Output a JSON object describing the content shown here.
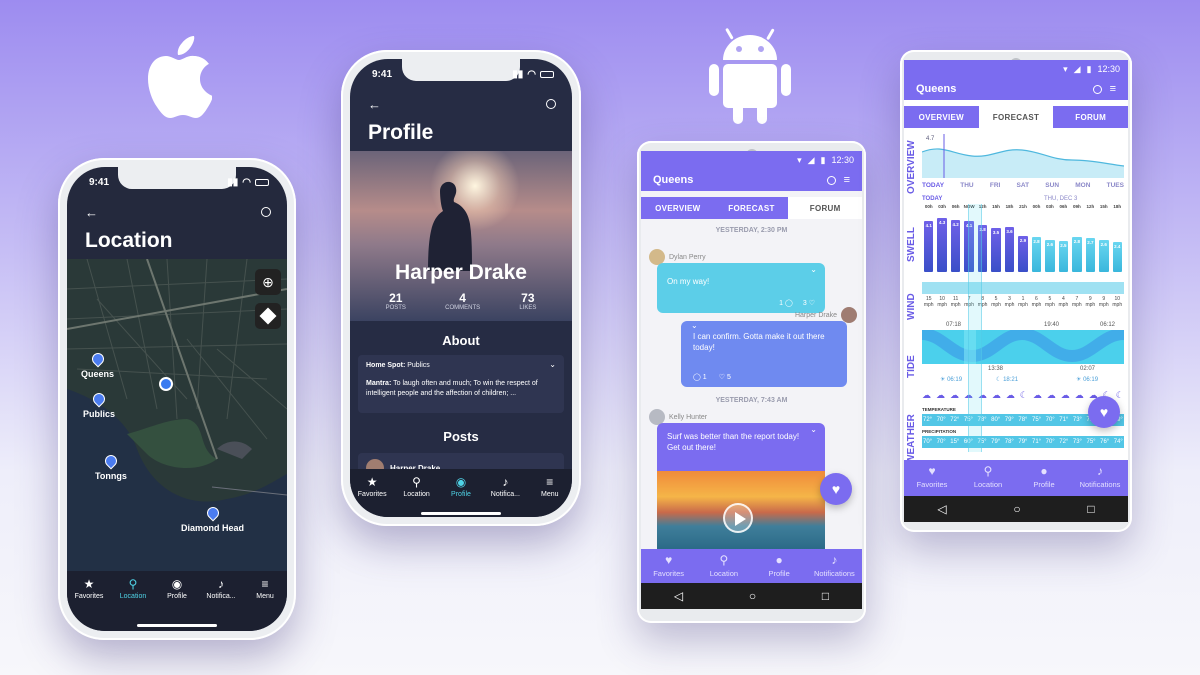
{
  "phone1": {
    "time": "9:41",
    "title": "Location",
    "map_labels": {
      "queens": "Queens",
      "publics": "Publics",
      "tonngs": "Tonngs",
      "diamond_head": "Diamond Head"
    },
    "tabs": [
      {
        "label": "Favorites",
        "icon": "star-icon"
      },
      {
        "label": "Location",
        "icon": "location-pin-icon"
      },
      {
        "label": "Profile",
        "icon": "user-icon"
      },
      {
        "label": "Notifica...",
        "icon": "bell-icon"
      },
      {
        "label": "Menu",
        "icon": "sliders-icon"
      }
    ]
  },
  "phone2": {
    "time": "9:41",
    "title": "Profile",
    "name": "Harper Drake",
    "stats": [
      {
        "value": "21",
        "label": "POSTS"
      },
      {
        "value": "4",
        "label": "COMMENTS"
      },
      {
        "value": "73",
        "label": "LIKES"
      }
    ],
    "about_heading": "About",
    "home_spot_label": "Home Spot:",
    "home_spot_value": "Publics",
    "mantra_label": "Mantra:",
    "mantra_value": "To laugh often and much; To win the respect of intelligent people and the affection of children; ...",
    "posts_heading": "Posts",
    "post_author": "Harper Drake",
    "tabs": [
      {
        "label": "Favorites",
        "icon": "star-icon"
      },
      {
        "label": "Location",
        "icon": "location-pin-icon"
      },
      {
        "label": "Profile",
        "icon": "user-icon"
      },
      {
        "label": "Notifica...",
        "icon": "bell-icon"
      },
      {
        "label": "Menu",
        "icon": "sliders-icon"
      }
    ]
  },
  "phone3": {
    "time": "12:30",
    "title": "Queens",
    "tabs": [
      "OVERVIEW",
      "FORECAST",
      "FORUM"
    ],
    "day1": "YESTERDAY, 2:30 PM",
    "msg1": {
      "author": "Dylan Perry",
      "text": "On my way!",
      "comments": "1",
      "likes": "3"
    },
    "msg2": {
      "author": "Harper Drake",
      "text": "I can confirm. Gotta make it out there today!",
      "comments": "1",
      "likes": "5"
    },
    "day2": "YESTERDAY, 7:43 AM",
    "msg3": {
      "author": "Kelly Hunter",
      "text": "Surf was better than the report today! Get out there!"
    },
    "nav": [
      {
        "label": "Favorites",
        "icon": "heart-icon"
      },
      {
        "label": "Location",
        "icon": "location-pin-icon"
      },
      {
        "label": "Profile",
        "icon": "user-icon"
      },
      {
        "label": "Notifications",
        "icon": "bell-icon"
      }
    ]
  },
  "phone4": {
    "time": "12:30",
    "title": "Queens",
    "tabs": [
      "OVERVIEW",
      "FORECAST",
      "FORUM"
    ],
    "side_labels": [
      "OVERVIEW",
      "SWELL",
      "WIND",
      "TIDE",
      "WEATHER"
    ],
    "overview_value": "4.7",
    "days": [
      "TODAY",
      "THU",
      "FRI",
      "SAT",
      "SUN",
      "MON",
      "TUES"
    ],
    "subheads": {
      "today": "TODAY",
      "next": "THU, DEC 3"
    },
    "hours": [
      "00h",
      "03h",
      "06h",
      "NOW",
      "12h",
      "15h",
      "18h",
      "21h",
      "00h",
      "03h",
      "06h",
      "09h",
      "12h",
      "15h",
      "18h"
    ],
    "swell": [
      "4.1",
      "4.3",
      "4.2",
      "4.1",
      "3.8",
      "3.5",
      "3.6",
      "2.9",
      "2.8",
      "2.6",
      "2.5",
      "2.8",
      "2.7",
      "2.6",
      "2.4"
    ],
    "wind_speeds": [
      "15",
      "10",
      "11",
      "7",
      "8",
      "5",
      "3",
      "1",
      "6",
      "5",
      "4",
      "7",
      "9",
      "9",
      "10"
    ],
    "wind_unit": "mph",
    "tide_times": {
      "t1": "07:18",
      "t2": "13:38",
      "t3": "19:40",
      "t4": "02:07",
      "t5": "06:12"
    },
    "sun_times": {
      "s1": "06:19",
      "s2": "18:21",
      "s3": "06:19"
    },
    "temperature_label": "TEMPERATURE",
    "temps": [
      "72°",
      "70°",
      "72°",
      "75°",
      "78°",
      "80°",
      "79°",
      "78°",
      "75°",
      "70°",
      "71°",
      "73°",
      "75°",
      "77°",
      "79°"
    ],
    "precipitation_label": "PRECIPITATION",
    "precip": [
      "70°",
      "70°",
      "15°",
      "60°",
      "75°",
      "79°",
      "78°",
      "79°",
      "71°",
      "70°",
      "72°",
      "73°",
      "75°",
      "76°",
      "74°"
    ],
    "nav": [
      {
        "label": "Favorites",
        "icon": "heart-icon"
      },
      {
        "label": "Location",
        "icon": "location-pin-icon"
      },
      {
        "label": "Profile",
        "icon": "user-icon"
      },
      {
        "label": "Notifications",
        "icon": "bell-icon"
      }
    ]
  }
}
